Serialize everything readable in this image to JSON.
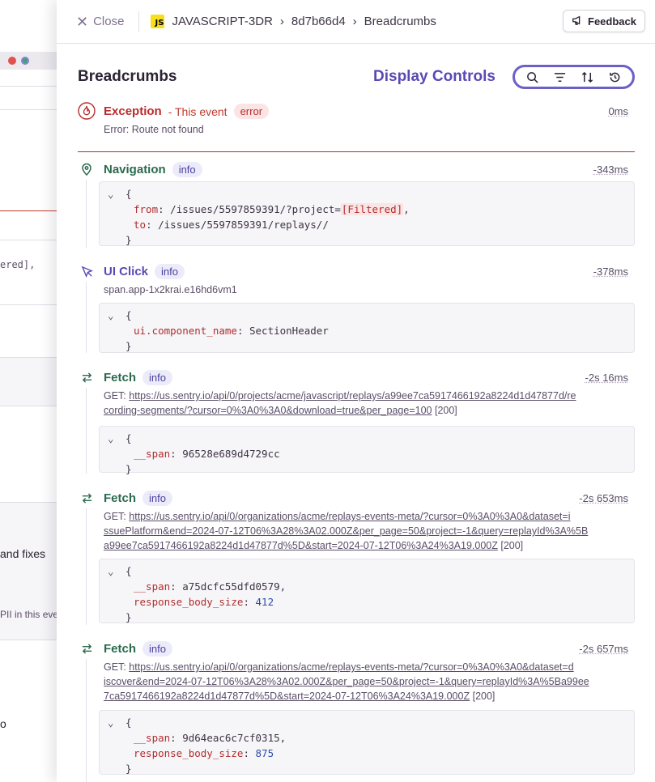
{
  "background": {
    "fragments": [
      "ered],",
      "and fixes",
      "PII in this eve",
      "o"
    ]
  },
  "topbar": {
    "close_label": "Close",
    "project_badge": "JS",
    "project": "JAVASCRIPT-3DR",
    "event_id": "8d7b66d4",
    "current": "Breadcrumbs",
    "feedback_label": "Feedback"
  },
  "header": {
    "title": "Breadcrumbs",
    "display_controls_label": "Display Controls",
    "controls": [
      "search-icon",
      "filter-icon",
      "sort-icon",
      "time-format-icon"
    ]
  },
  "items": [
    {
      "type": "Exception",
      "suffix": "- This event",
      "level": "error",
      "time": "0ms",
      "description": "Error: Route not found",
      "color": "#b92c2c"
    },
    {
      "type": "Navigation",
      "level": "info",
      "time": "-343ms",
      "color": "#2b6a4e",
      "code": {
        "from_key": "from",
        "from_val": "/issues/5597859391/?project=",
        "from_filtered": "[Filtered]",
        "from_tail": ",",
        "to_key": "to",
        "to_val": "/issues/5597859391/replays//"
      }
    },
    {
      "type": "UI Click",
      "level": "info",
      "time": "-378ms",
      "color": "#5b49b3",
      "description": "span.app-1x2krai.e16hd6vm1",
      "code": {
        "key": "ui.component_name",
        "val": "SectionHeader"
      }
    },
    {
      "type": "Fetch",
      "level": "info",
      "time": "-2s 16ms",
      "color": "#2b6a4e",
      "method": "GET:",
      "url_line1": "https://us.sentry.io/api/0/projects/acme/javascript/replays/a99ee7ca5917466192a8224d1d47877d/re",
      "url_line2": "cording-segments/?cursor=0%3A0%3A0&download=true&per_page=100",
      "status": "[200]",
      "code": {
        "key": "__span",
        "val": "96528e689d4729cc"
      }
    },
    {
      "type": "Fetch",
      "level": "info",
      "time": "-2s 653ms",
      "color": "#2b6a4e",
      "method": "GET:",
      "url_line1": "https://us.sentry.io/api/0/organizations/acme/replays-events-meta/?cursor=0%3A0%3A0&dataset=i",
      "url_line2": "ssuePlatform&end=2024-07-12T06%3A28%3A02.000Z&per_page=50&project=-1&query=replayId%3A%5B",
      "url_line3": "a99ee7ca5917466192a8224d1d47877d%5D&start=2024-07-12T06%3A24%3A19.000Z",
      "status": "[200]",
      "code": {
        "key": "__span",
        "val": "a75dcfc55dfd0579",
        "key2": "response_body_size",
        "val2": "412"
      }
    },
    {
      "type": "Fetch",
      "level": "info",
      "time": "-2s 657ms",
      "color": "#2b6a4e",
      "method": "GET:",
      "url_line1": "https://us.sentry.io/api/0/organizations/acme/replays-events-meta/?cursor=0%3A0%3A0&dataset=d",
      "url_line2": "iscover&end=2024-07-12T06%3A28%3A02.000Z&per_page=50&project=-1&query=replayId%3A%5Ba99ee",
      "url_line3": "7ca5917466192a8224d1d47877d%5D&start=2024-07-12T06%3A24%3A19.000Z",
      "status": "[200]",
      "code": {
        "key": "__span",
        "val": "9d64eac6c7cf0315",
        "key2": "response_body_size",
        "val2": "875"
      }
    }
  ],
  "code_open": "{",
  "code_close": "}"
}
